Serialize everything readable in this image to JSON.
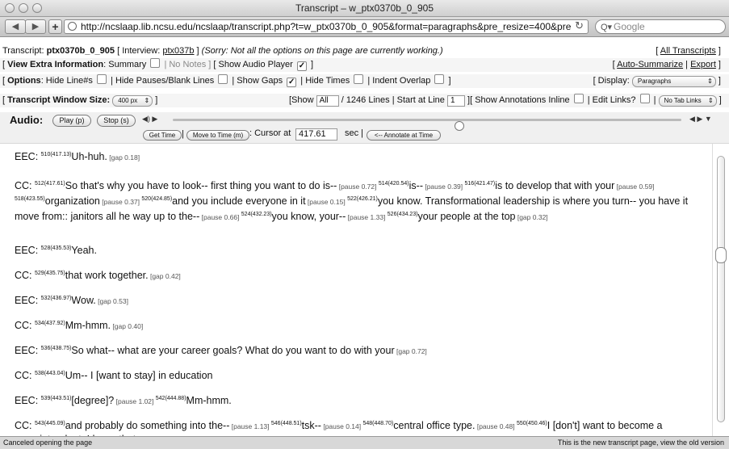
{
  "window": {
    "title": "Transcript – w_ptx0370b_0_905"
  },
  "toolbar": {
    "url": "http://ncslaap.lib.ncsu.edu/ncslaap/transcript.php?t=w_ptx0370b_0_905&format=paragraphs&pre_resize=400&pre",
    "search_placeholder": "Google"
  },
  "row1": {
    "transcript_label": "Transcript:",
    "transcript_id": "ptx0370b_0_905",
    "interview_prefix": "[ Interview:",
    "interview_link": "ptx037b",
    "interview_suffix": "]",
    "sorry": "(Sorry: Not all the options on this page are currently working.)",
    "all_transcripts": "All Transcripts"
  },
  "row2": {
    "label": "View Extra Information",
    "summary": ": Summary",
    "no_notes": "| No Notes ]",
    "audio_player": "[ Show Audio Player",
    "end": "]",
    "auto_summarize": "Auto-Summarize",
    "export": "Export"
  },
  "row3": {
    "label": "Options",
    "hide_line": ": Hide Line#s",
    "hide_pauses": "| Hide Pauses/Blank Lines",
    "show_gaps": "| Show Gaps",
    "hide_times": "| Hide Times",
    "indent_overlap": "| Indent Overlap",
    "end": "]",
    "display_label": "[ Display:",
    "display_value": "Paragraphs"
  },
  "row4": {
    "label": "Transcript Window Size:",
    "window_size": "400 px",
    "show_label": "[Show",
    "show_value": "All",
    "lines": "/ 1246 Lines | Start at Line",
    "start_line": "1",
    "annotations": "][ Show Annotations Inline",
    "edit_links": "| Edit Links?",
    "tab_links": "No Tab Links"
  },
  "audio": {
    "label": "Audio:",
    "play": "Play (p)",
    "stop": "Stop (s)",
    "get_time": "Get Time",
    "move_to_time": "Move to Time (m)",
    "cursor_label": ": Cursor at",
    "cursor_value": "417.61",
    "sec": "sec |",
    "annotate": "<-- Annotate at Time"
  },
  "turns": [
    {
      "speaker": "EEC:",
      "segments": [
        {
          "num": "510",
          "ts": "(417.13)",
          "text": "Uh-huh."
        },
        {
          "pause": "[gap 0.18]"
        }
      ]
    },
    {
      "speaker": "CC:",
      "segments": [
        {
          "num": "512",
          "ts": "(417.61)",
          "text": "So that's why you have to look-- first thing you want to do is--"
        },
        {
          "pause": "[pause 0.72]"
        },
        {
          "num": "514",
          "ts": "(420.54)",
          "text": "is--"
        },
        {
          "pause": "[pause 0.39]"
        },
        {
          "num": "516",
          "ts": "(421.47)",
          "text": "is to develop that with your"
        },
        {
          "pause": "[pause 0.59]"
        },
        {
          "num": "518",
          "ts": "(423.55)",
          "text": "organization"
        },
        {
          "pause": "[pause 0.37]"
        },
        {
          "num": "520",
          "ts": "(424.85)",
          "text": "and you include everyone in it"
        },
        {
          "pause": "[pause 0.15]"
        },
        {
          "num": "522",
          "ts": "(426.21)",
          "text": "you know. Transformational leadership is where you turn-- you have it move from:: janitors all he way up to the--"
        },
        {
          "pause": "[pause 0.66]"
        },
        {
          "num": "524",
          "ts": "(432.23)",
          "text": "you know, your--"
        },
        {
          "pause": "[pause 1.33]"
        },
        {
          "num": "526",
          "ts": "(434.23)",
          "text": "your people at the top"
        },
        {
          "pause": "[gap 0.32]"
        }
      ]
    },
    {
      "speaker": "EEC:",
      "segments": [
        {
          "num": "528",
          "ts": "(435.53)",
          "text": "Yeah."
        }
      ]
    },
    {
      "speaker": "CC:",
      "segments": [
        {
          "num": "529",
          "ts": "(435.75)",
          "text": "that work together."
        },
        {
          "pause": "[gap 0.42]"
        }
      ]
    },
    {
      "speaker": "EEC:",
      "segments": [
        {
          "num": "532",
          "ts": "(436.97)",
          "text": "Wow."
        },
        {
          "pause": "[gap 0.53]"
        }
      ]
    },
    {
      "speaker": "CC:",
      "segments": [
        {
          "num": "534",
          "ts": "(437.92)",
          "text": "Mm-hmm."
        },
        {
          "pause": "[gap 0.40]"
        }
      ]
    },
    {
      "speaker": "EEC:",
      "segments": [
        {
          "num": "536",
          "ts": "(438.75)",
          "text": "So what-- what are your career goals? What do you want to do with your"
        },
        {
          "pause": "[gap 0.72]"
        }
      ]
    },
    {
      "speaker": "CC:",
      "segments": [
        {
          "num": "538",
          "ts": "(443.04)",
          "text": "Um-- I [want to stay] in education"
        }
      ]
    },
    {
      "speaker": "EEC:",
      "segments": [
        {
          "num": "539",
          "ts": "(443.51)",
          "text": "[degree]?"
        },
        {
          "pause": "[pause 1.02]"
        },
        {
          "num": "542",
          "ts": "(444.88)",
          "text": "Mm-hmm."
        }
      ]
    },
    {
      "speaker": "CC:",
      "segments": [
        {
          "num": "543",
          "ts": "(445.09)",
          "text": "and probably do something into the--"
        },
        {
          "pause": "[pause 1.13]"
        },
        {
          "num": "546",
          "ts": "(448.51)",
          "text": "tsk--"
        },
        {
          "pause": "[pause 0.14]"
        },
        {
          "num": "548",
          "ts": "(448.70)",
          "text": "central office type."
        },
        {
          "pause": "[pause 0.48]"
        },
        {
          "num": "550",
          "ts": "(450.46)",
          "text": "I [don't] want to become a superintendent. I know that, so--"
        }
      ]
    }
  ],
  "status": {
    "text": "Canceled opening the page",
    "right": "This is the new transcript page, view the old version"
  }
}
